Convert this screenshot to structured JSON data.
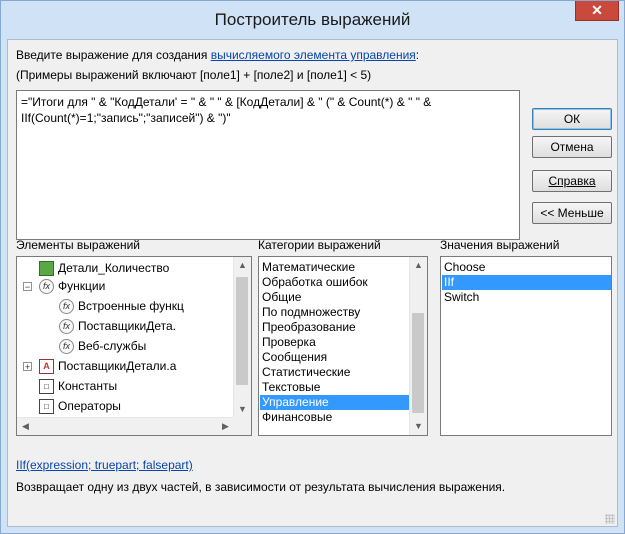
{
  "window": {
    "title": "Построитель выражений",
    "close_glyph": "✕"
  },
  "instructions": {
    "prefix": "Введите выражение для создания ",
    "link": "вычисляемого элемента управления",
    "suffix": ":",
    "examples": "(Примеры выражений включают [поле1] + [поле2] и [поле1] < 5)"
  },
  "expression": {
    "value": "=\"Итоги для \" & \"КодДетали' = \" & \" \" & [КодДетали] & \" (\" & Count(*) & \" \" & IIf(Count(*)=1;\"запись\";\"записей\") & \")\""
  },
  "buttons": {
    "ok": "ОК",
    "cancel": "Отмена",
    "help": "Справка",
    "less": "<< Меньше"
  },
  "elements_panel": {
    "label": "Элементы выражений",
    "items": [
      {
        "label": "Детали_Количество",
        "icon": "table-icon"
      },
      {
        "label": "Функции",
        "icon": "function-icon",
        "expander": "−"
      },
      {
        "label": "Встроенные функц",
        "icon": "function-icon"
      },
      {
        "label": "ПоставщикиДета.",
        "icon": "function-icon"
      },
      {
        "label": "Веб-службы",
        "icon": "function-icon"
      },
      {
        "label": "ПоставщикиДетали.а",
        "icon": "form-icon",
        "expander": "+"
      },
      {
        "label": "Константы",
        "icon": "constants-icon"
      },
      {
        "label": "Операторы",
        "icon": "operators-icon"
      }
    ]
  },
  "categories_panel": {
    "label": "Категории выражений",
    "items": [
      "Математические",
      "Обработка ошибок",
      "Общие",
      "По подмножеству",
      "Преобразование",
      "Проверка",
      "Сообщения",
      "Статистические",
      "Текстовые",
      "Управление",
      "Финансовые"
    ],
    "selected": "Управление"
  },
  "values_panel": {
    "label": "Значения выражений",
    "items": [
      "Choose",
      "IIf",
      "Switch"
    ],
    "selected": "IIf"
  },
  "footer": {
    "syntax_link": "IIf(expression; truepart; falsepart)",
    "description": "Возвращает одну из двух частей, в зависимости от результата вычисления выражения."
  },
  "colors": {
    "selection": "#3399ff",
    "title_bar": "#cfe2f6",
    "close_button": "#c9493c",
    "link": "#0645ad"
  }
}
